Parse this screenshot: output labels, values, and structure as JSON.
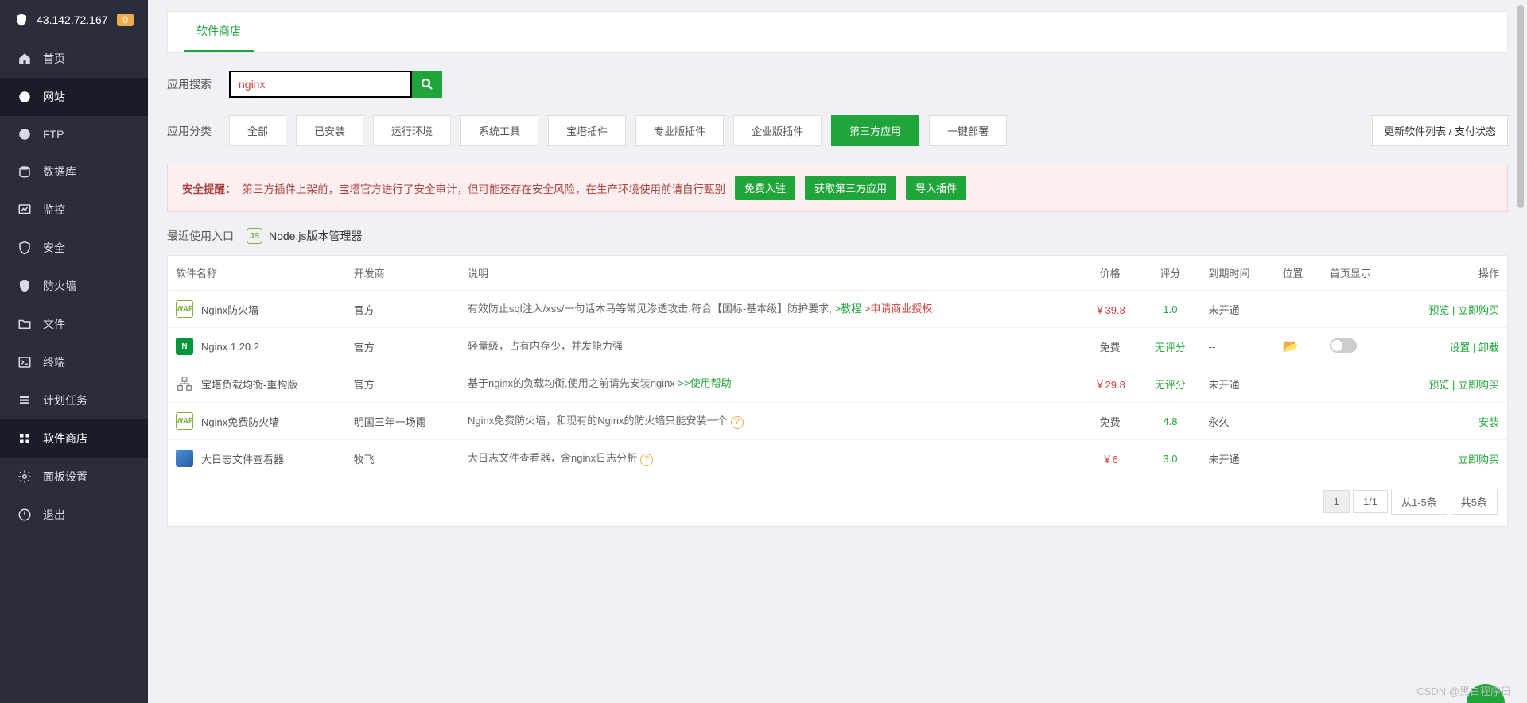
{
  "header": {
    "ip": "43.142.72.167",
    "count": "0"
  },
  "sidebar": {
    "items": [
      {
        "label": "首页",
        "icon": "home"
      },
      {
        "label": "网站",
        "icon": "site",
        "active": true
      },
      {
        "label": "FTP",
        "icon": "ftp"
      },
      {
        "label": "数据库",
        "icon": "db"
      },
      {
        "label": "监控",
        "icon": "monitor"
      },
      {
        "label": "安全",
        "icon": "security"
      },
      {
        "label": "防火墙",
        "icon": "firewall"
      },
      {
        "label": "文件",
        "icon": "file"
      },
      {
        "label": "终端",
        "icon": "terminal"
      },
      {
        "label": "计划任务",
        "icon": "cron"
      },
      {
        "label": "软件商店",
        "icon": "store",
        "active2": true
      },
      {
        "label": "面板设置",
        "icon": "settings"
      },
      {
        "label": "退出",
        "icon": "logout"
      }
    ]
  },
  "tab": {
    "label": "软件商店"
  },
  "search": {
    "label": "应用搜索",
    "value": "nginx"
  },
  "categories": {
    "label": "应用分类",
    "buttons": [
      "全部",
      "已安装",
      "运行环境",
      "系统工具",
      "宝塔插件",
      "专业版插件",
      "企业版插件",
      "第三方应用",
      "一键部署"
    ],
    "active_index": 7,
    "update_label": "更新软件列表 / 支付状态"
  },
  "alert": {
    "prefix": "安全提醒：",
    "text": "第三方插件上架前，宝塔官方进行了安全审计，但可能还存在安全风险，在生产环境使用前请自行甄别",
    "btn1": "免费入驻",
    "btn2": "获取第三方应用",
    "btn3": "导入插件"
  },
  "recent": {
    "label": "最近使用入口",
    "item": "Node.js版本管理器"
  },
  "table": {
    "headers": [
      "软件名称",
      "开发商",
      "说明",
      "价格",
      "评分",
      "到期时间",
      "位置",
      "首页显示",
      "操作"
    ],
    "rows": [
      {
        "name": "Nginx防火墙",
        "dev": "官方",
        "desc_main": "有效防止sql注入/xss/一句话木马等常见渗透攻击,符合【国标-基本级】防护要求,  ",
        "desc_link1": ">教程",
        "desc_link2": ">申请商业授权",
        "price": "￥39.8",
        "price_red": true,
        "rating": "1.0",
        "expire": "未开通",
        "action": "预览 | 立即购买"
      },
      {
        "name": "Nginx 1.20.2",
        "dev": "官方",
        "desc_main": "轻量级，占有内存少，并发能力强",
        "price": "免费",
        "rating": "无评分",
        "expire": "--",
        "folder": true,
        "toggle": true,
        "action": "设置 | 卸载"
      },
      {
        "name": "宝塔负载均衡-重构版",
        "dev": "官方",
        "desc_main": "基于nginx的负载均衡,使用之前请先安装nginx ",
        "desc_link1": ">>使用帮助",
        "price": "￥29.8",
        "price_red": true,
        "rating": "无评分",
        "expire": "未开通",
        "action": "预览 | 立即购买"
      },
      {
        "name": "Nginx免费防火墙",
        "dev": "明国三年一场雨",
        "desc_main": "Nginx免费防火墙，和现有的Nginx的防火墙只能安装一个",
        "qmark": true,
        "price": "免费",
        "rating": "4.8",
        "expire": "永久",
        "action": "安装"
      },
      {
        "name": "大日志文件查看器",
        "dev": "牧飞",
        "desc_main": "大日志文件查看器，含nginx日志分析",
        "qmark": true,
        "price": "￥6",
        "price_red": true,
        "rating": "3.0",
        "expire": "未开通",
        "action": "立即购买"
      }
    ]
  },
  "pagination": {
    "page": "1",
    "total": "1/1",
    "range": "从1-5条",
    "count": "共5条"
  },
  "watermark": "CSDN @黑白程序员"
}
